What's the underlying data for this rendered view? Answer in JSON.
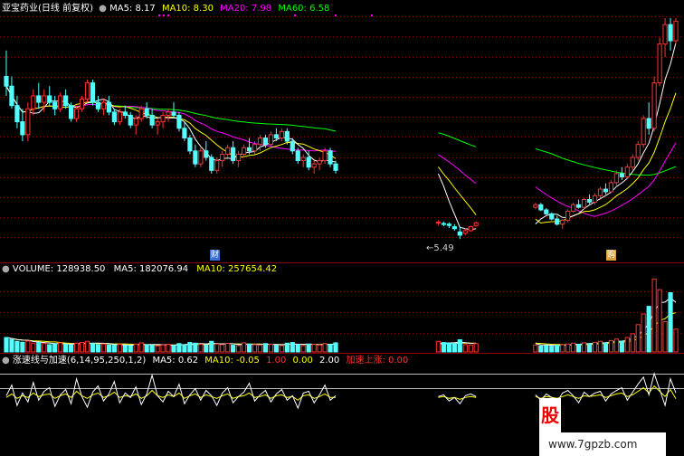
{
  "header": {
    "title": "亚宝药业(日线 前复权)",
    "ma5": "MA5: 8.17",
    "ma10": "MA10: 8.30",
    "ma20": "MA20: 7.98",
    "ma60": "MA60: 6.58"
  },
  "volume_header": {
    "label": "VOLUME: 128938.50",
    "ma5": "MA5: 182076.94",
    "ma10": "MA10: 257654.42"
  },
  "indicator_header": {
    "label": "涨速线与加速(6,14,95,250,1,2)",
    "ma5": "MA5: 0.62",
    "ma10": "MA10: -0.05",
    "v1": "1.00",
    "v2": "0.00",
    "v3": "2.00",
    "signal": "加速上涨: 0.00"
  },
  "price_annotation": "5.49",
  "badges": {
    "cai": "财",
    "gou": "购"
  },
  "watermark": {
    "logo": "股",
    "url": "www.7gpzb.com"
  },
  "colors": {
    "up": "#ff3232",
    "down": "#54ffff",
    "ma5": "#ffffff",
    "ma10": "#ffff00",
    "ma20": "#ff00ff",
    "ma60": "#00ff00",
    "grid": "#8b0000"
  },
  "chart_data": [
    {
      "type": "candlestick",
      "title": "亚宝药业(日线 前复权)",
      "ylim": [
        5.2,
        8.9
      ],
      "ohlc": [
        [
          8.0,
          8.4,
          7.7,
          7.85
        ],
        [
          7.85,
          8.0,
          7.5,
          7.55
        ],
        [
          7.55,
          7.7,
          7.2,
          7.3
        ],
        [
          7.3,
          7.5,
          7.0,
          7.1
        ],
        [
          7.1,
          7.6,
          7.0,
          7.5
        ],
        [
          7.5,
          7.8,
          7.4,
          7.7
        ],
        [
          7.7,
          7.9,
          7.5,
          7.6
        ],
        [
          7.6,
          7.8,
          7.45,
          7.7
        ],
        [
          7.7,
          7.85,
          7.55,
          7.6
        ],
        [
          7.6,
          7.7,
          7.4,
          7.5
        ],
        [
          7.5,
          7.75,
          7.45,
          7.7
        ],
        [
          7.7,
          7.8,
          7.5,
          7.55
        ],
        [
          7.55,
          7.6,
          7.3,
          7.35
        ],
        [
          7.35,
          7.55,
          7.3,
          7.5
        ],
        [
          7.5,
          7.7,
          7.45,
          7.65
        ],
        [
          7.65,
          7.95,
          7.6,
          7.9
        ],
        [
          7.9,
          7.95,
          7.55,
          7.6
        ],
        [
          7.6,
          7.7,
          7.45,
          7.5
        ],
        [
          7.5,
          7.65,
          7.4,
          7.6
        ],
        [
          7.6,
          7.7,
          7.4,
          7.45
        ],
        [
          7.45,
          7.5,
          7.25,
          7.3
        ],
        [
          7.3,
          7.5,
          7.25,
          7.45
        ],
        [
          7.45,
          7.55,
          7.35,
          7.4
        ],
        [
          7.4,
          7.45,
          7.2,
          7.25
        ],
        [
          7.25,
          7.4,
          7.1,
          7.35
        ],
        [
          7.35,
          7.55,
          7.3,
          7.5
        ],
        [
          7.5,
          7.6,
          7.35,
          7.4
        ],
        [
          7.4,
          7.5,
          7.2,
          7.25
        ],
        [
          7.25,
          7.35,
          7.1,
          7.3
        ],
        [
          7.3,
          7.45,
          7.2,
          7.4
        ],
        [
          7.4,
          7.5,
          7.3,
          7.45
        ],
        [
          7.45,
          7.6,
          7.35,
          7.4
        ],
        [
          7.4,
          7.45,
          7.15,
          7.2
        ],
        [
          7.2,
          7.3,
          7.0,
          7.05
        ],
        [
          7.05,
          7.1,
          6.8,
          6.85
        ],
        [
          6.85,
          6.95,
          6.6,
          6.65
        ],
        [
          6.65,
          6.9,
          6.6,
          6.85
        ],
        [
          6.85,
          7.0,
          6.7,
          6.75
        ],
        [
          6.75,
          6.8,
          6.5,
          6.55
        ],
        [
          6.55,
          6.75,
          6.5,
          6.7
        ],
        [
          6.7,
          6.85,
          6.6,
          6.8
        ],
        [
          6.8,
          6.95,
          6.75,
          6.9
        ],
        [
          6.9,
          7.0,
          6.65,
          6.7
        ],
        [
          6.7,
          6.85,
          6.6,
          6.8
        ],
        [
          6.8,
          6.95,
          6.75,
          6.9
        ],
        [
          6.9,
          7.05,
          6.8,
          6.85
        ],
        [
          6.85,
          7.0,
          6.8,
          6.95
        ],
        [
          6.95,
          7.1,
          6.85,
          7.05
        ],
        [
          7.05,
          7.1,
          6.9,
          6.95
        ],
        [
          6.95,
          7.15,
          6.9,
          7.1
        ],
        [
          7.1,
          7.2,
          7.0,
          7.05
        ],
        [
          7.05,
          7.2,
          7.0,
          7.15
        ],
        [
          7.15,
          7.2,
          6.95,
          7.0
        ],
        [
          7.0,
          7.05,
          6.8,
          6.85
        ],
        [
          6.85,
          6.9,
          6.65,
          6.7
        ],
        [
          6.7,
          6.8,
          6.6,
          6.75
        ],
        [
          6.75,
          6.85,
          6.55,
          6.6
        ],
        [
          6.6,
          6.7,
          6.5,
          6.65
        ],
        [
          6.65,
          6.75,
          6.55,
          6.7
        ],
        [
          6.7,
          6.9,
          6.65,
          6.85
        ],
        [
          6.85,
          6.9,
          6.6,
          6.65
        ],
        [
          6.65,
          6.7,
          6.5,
          6.55
        ],
        null,
        null,
        null,
        null,
        null,
        null,
        null,
        null,
        null,
        null,
        null,
        null,
        null,
        null,
        null,
        null,
        null,
        null,
        [
          5.75,
          5.78,
          5.7,
          5.75
        ],
        [
          5.73,
          5.76,
          5.69,
          5.72
        ],
        [
          5.72,
          5.75,
          5.66,
          5.7
        ],
        [
          5.68,
          5.72,
          5.62,
          5.65
        ],
        [
          5.6,
          5.68,
          5.49,
          5.55
        ],
        [
          5.58,
          5.65,
          5.55,
          5.62
        ],
        [
          5.62,
          5.7,
          5.6,
          5.68
        ],
        [
          5.7,
          5.76,
          5.68,
          5.74
        ],
        null,
        null,
        null,
        null,
        null,
        null,
        null,
        null,
        null,
        null,
        [
          5.98,
          6.05,
          5.95,
          6.02
        ],
        [
          6.02,
          6.05,
          5.92,
          5.94
        ],
        [
          5.94,
          5.97,
          5.86,
          5.88
        ],
        [
          5.88,
          5.9,
          5.78,
          5.8
        ],
        [
          5.8,
          5.85,
          5.7,
          5.72
        ],
        [
          5.72,
          5.8,
          5.65,
          5.78
        ],
        [
          5.78,
          5.95,
          5.75,
          5.92
        ],
        [
          5.92,
          6.05,
          5.9,
          6.02
        ],
        [
          6.02,
          6.1,
          5.96,
          5.98
        ],
        [
          5.98,
          6.12,
          5.95,
          6.1
        ],
        [
          6.1,
          6.18,
          6.03,
          6.06
        ],
        [
          6.06,
          6.2,
          6.02,
          6.16
        ],
        [
          6.16,
          6.3,
          6.12,
          6.26
        ],
        [
          6.26,
          6.35,
          6.18,
          6.22
        ],
        [
          6.22,
          6.4,
          6.2,
          6.36
        ],
        [
          6.36,
          6.55,
          6.3,
          6.5
        ],
        [
          6.5,
          6.6,
          6.4,
          6.45
        ],
        [
          6.45,
          6.65,
          6.42,
          6.6
        ],
        [
          6.6,
          6.8,
          6.55,
          6.75
        ],
        [
          6.75,
          7.0,
          6.7,
          6.95
        ],
        [
          6.95,
          7.4,
          6.9,
          7.35
        ],
        [
          7.35,
          7.6,
          7.1,
          7.2
        ],
        [
          7.2,
          8.0,
          7.15,
          7.9
        ],
        [
          7.9,
          8.6,
          7.85,
          8.5
        ],
        [
          8.5,
          8.9,
          8.3,
          8.8
        ],
        [
          8.8,
          8.9,
          8.4,
          8.55
        ],
        [
          8.55,
          8.9,
          8.5,
          8.85
        ]
      ],
      "ma_series": [
        {
          "name": "MA5",
          "value": 8.17
        },
        {
          "name": "MA10",
          "value": 8.3
        },
        {
          "name": "MA20",
          "value": 7.98
        },
        {
          "name": "MA60",
          "value": 6.58
        }
      ],
      "annotations": [
        "5.49"
      ]
    },
    {
      "type": "bar",
      "title": "VOLUME",
      "ylim": [
        0,
        500000
      ],
      "values": [
        95000,
        82000,
        70000,
        64000,
        72000,
        58000,
        62000,
        55000,
        48000,
        52000,
        60000,
        50000,
        45000,
        58000,
        62000,
        70000,
        55000,
        48000,
        52000,
        46000,
        44000,
        50000,
        42000,
        40000,
        52000,
        60000,
        48000,
        44000,
        40000,
        46000,
        50000,
        42000,
        55000,
        48000,
        62000,
        58000,
        50000,
        46000,
        70000,
        52000,
        48000,
        56000,
        44000,
        42000,
        60000,
        52000,
        48000,
        46000,
        55000,
        50000,
        44000,
        42000,
        58000,
        62000,
        48000,
        42000,
        52000,
        50000,
        46000,
        55000,
        48000,
        60000,
        null,
        null,
        null,
        null,
        null,
        null,
        null,
        null,
        null,
        null,
        null,
        null,
        null,
        null,
        null,
        null,
        null,
        null,
        70000,
        62000,
        58000,
        55000,
        80000,
        48000,
        46000,
        55000,
        null,
        null,
        null,
        null,
        null,
        null,
        null,
        null,
        null,
        null,
        46000,
        40000,
        42000,
        38000,
        44000,
        48000,
        52000,
        58000,
        50000,
        60000,
        55000,
        62000,
        70000,
        58000,
        75000,
        85000,
        70000,
        95000,
        120000,
        180000,
        250000,
        300000,
        480000,
        410000,
        200000,
        390000,
        150000
      ],
      "up": [
        false,
        false,
        false,
        false,
        true,
        true,
        false,
        true,
        false,
        false,
        true,
        false,
        false,
        true,
        true,
        true,
        false,
        false,
        true,
        false,
        false,
        true,
        false,
        false,
        true,
        true,
        false,
        false,
        true,
        true,
        true,
        false,
        false,
        false,
        false,
        false,
        true,
        false,
        false,
        true,
        true,
        true,
        false,
        true,
        true,
        false,
        true,
        true,
        false,
        true,
        false,
        true,
        false,
        false,
        false,
        true,
        false,
        true,
        true,
        true,
        false,
        false,
        null,
        null,
        null,
        null,
        null,
        null,
        null,
        null,
        null,
        null,
        null,
        null,
        null,
        null,
        null,
        null,
        null,
        null,
        true,
        false,
        false,
        false,
        false,
        true,
        true,
        true,
        null,
        null,
        null,
        null,
        null,
        null,
        null,
        null,
        null,
        null,
        true,
        false,
        false,
        false,
        false,
        true,
        true,
        true,
        false,
        true,
        false,
        true,
        true,
        false,
        true,
        true,
        false,
        true,
        true,
        true,
        true,
        false,
        true,
        true,
        true,
        false,
        true
      ],
      "ma": [
        {
          "name": "MA5",
          "value": 182076.94
        },
        {
          "name": "MA10",
          "value": 257654.42
        }
      ]
    },
    {
      "type": "line",
      "title": "涨速线与加速(6,14,95,250,1,2)",
      "series": [
        {
          "name": "MA5",
          "values": [
            0.3,
            1.5,
            -0.8,
            0.6,
            -0.4,
            1.8,
            -0.2,
            0.8,
            1.2,
            -0.9,
            0.4,
            1.0,
            -0.6,
            2.2,
            0.2,
            -1.0,
            0.7,
            1.4,
            -0.3,
            0.5,
            1.9,
            -0.5,
            0.6,
            0.1,
            1.3,
            -0.7,
            0.5,
            2.6,
            0.3,
            -0.4,
            0.8,
            0.2,
            1.6,
            -0.6,
            0.4,
            1.1,
            -0.2,
            0.9,
            0.3,
            -0.8,
            0.6,
            1.2,
            -0.5,
            0.2,
            0.7,
            1.7,
            -0.3,
            0.4,
            0.9,
            -0.4,
            0.5,
            1.0,
            -0.2,
            0.3,
            -1.1,
            0.6,
            0.8,
            -0.5,
            0.4,
            1.5,
            -0.2,
            0.3,
            null,
            null,
            null,
            null,
            null,
            null,
            null,
            null,
            null,
            null,
            null,
            null,
            null,
            null,
            null,
            null,
            null,
            null,
            0.2,
            0.4,
            -0.3,
            0.1,
            -0.6,
            0.3,
            0.5,
            0.2,
            null,
            null,
            null,
            null,
            null,
            null,
            null,
            null,
            null,
            null,
            0.4,
            -0.2,
            0.5,
            0.1,
            -0.4,
            0.6,
            0.9,
            0.3,
            -0.5,
            0.7,
            0.2,
            0.6,
            0.8,
            -0.3,
            0.5,
            0.9,
            1.2,
            -0.2,
            0.7,
            1.6,
            2.4,
            0.4,
            2.8,
            1.0,
            -0.8,
            2.2,
            0.62
          ]
        },
        {
          "name": "MA10",
          "values": [
            0.1,
            0.5,
            0.0,
            0.3,
            0.1,
            0.6,
            0.2,
            0.4,
            0.5,
            0.0,
            0.3,
            0.5,
            0.1,
            0.8,
            0.3,
            0.0,
            0.4,
            0.6,
            0.1,
            0.3,
            0.7,
            0.1,
            0.3,
            0.2,
            0.5,
            0.0,
            0.3,
            0.9,
            0.3,
            0.1,
            0.4,
            0.2,
            0.6,
            0.0,
            0.3,
            0.5,
            0.1,
            0.4,
            0.2,
            0.0,
            0.3,
            0.5,
            0.0,
            0.2,
            0.3,
            0.6,
            0.1,
            0.2,
            0.4,
            0.0,
            0.3,
            0.4,
            0.1,
            0.2,
            -0.2,
            0.3,
            0.4,
            0.0,
            0.2,
            0.5,
            0.1,
            0.1,
            null,
            null,
            null,
            null,
            null,
            null,
            null,
            null,
            null,
            null,
            null,
            null,
            null,
            null,
            null,
            null,
            null,
            null,
            0.1,
            0.2,
            0.0,
            0.1,
            -0.1,
            0.1,
            0.2,
            0.1,
            null,
            null,
            null,
            null,
            null,
            null,
            null,
            null,
            null,
            null,
            0.2,
            0.0,
            0.2,
            0.1,
            0.0,
            0.2,
            0.4,
            0.2,
            0.0,
            0.3,
            0.2,
            0.3,
            0.4,
            0.1,
            0.3,
            0.5,
            0.6,
            0.2,
            0.4,
            0.8,
            1.2,
            0.6,
            1.4,
            0.8,
            0.2,
            1.0,
            -0.05
          ]
        }
      ],
      "signals": {
        "加速上涨": 0.0
      }
    }
  ]
}
